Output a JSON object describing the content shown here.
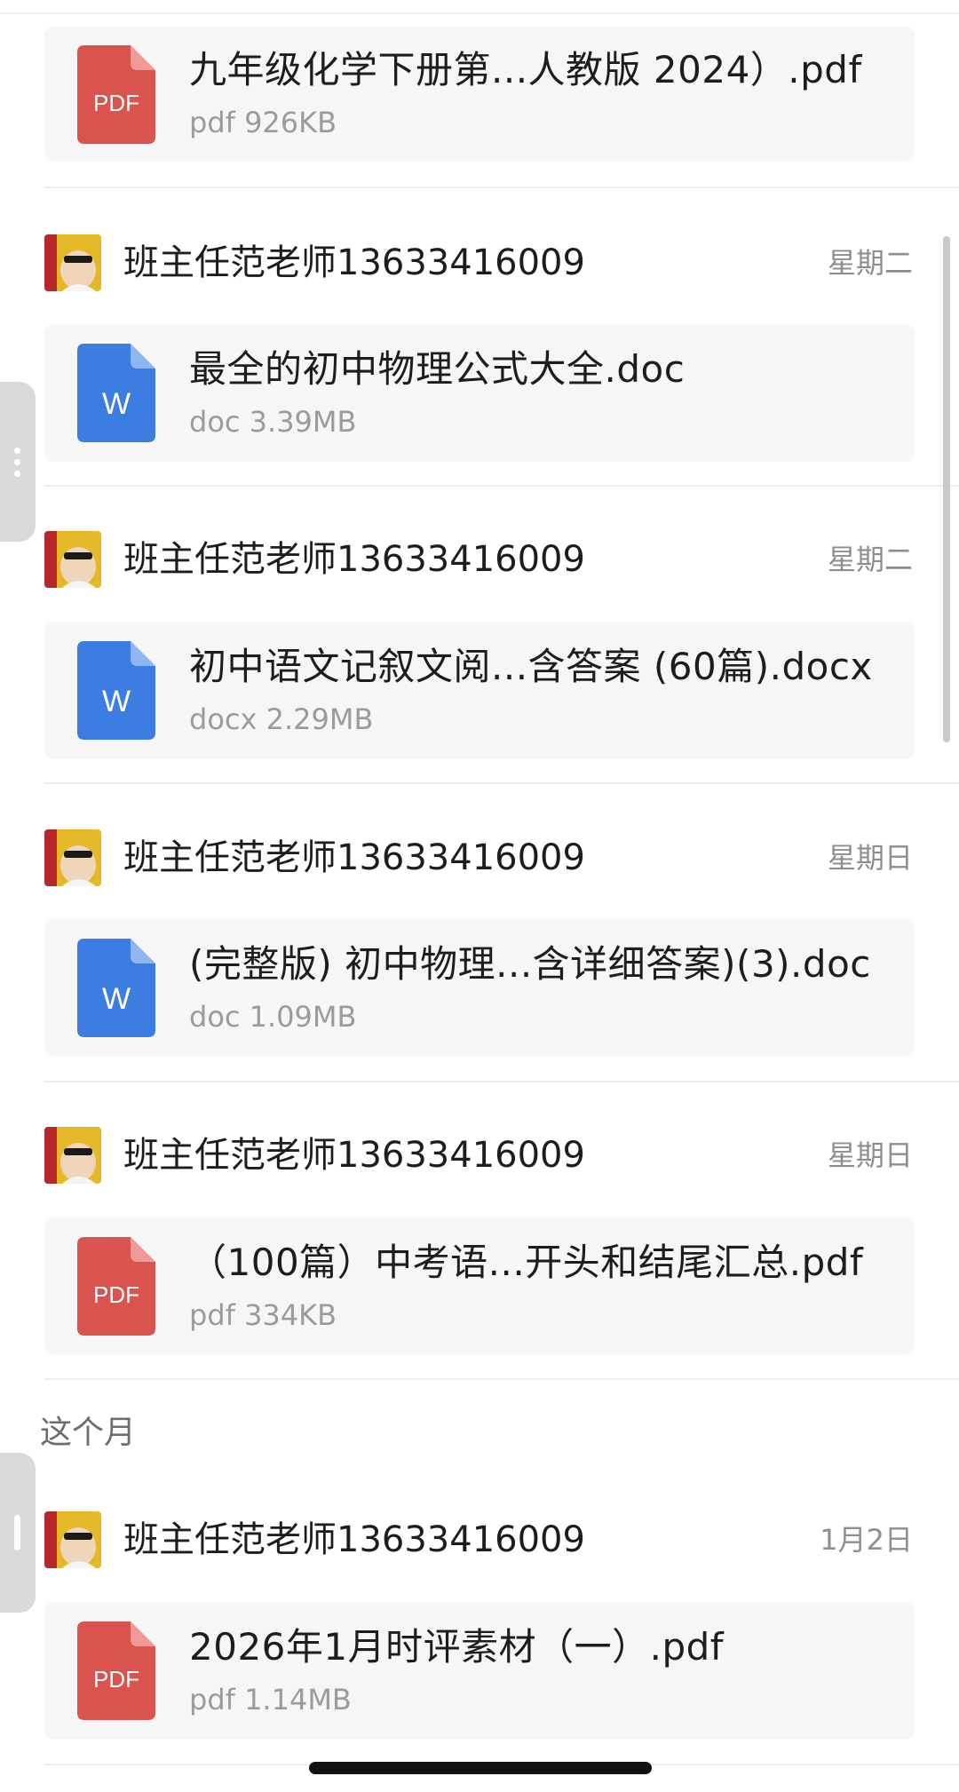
{
  "files": [
    {
      "name": "九年级化学下册第...人教版 2024）.pdf",
      "meta": "pdf 926KB",
      "type": "pdf",
      "icon_label": "PDF"
    },
    {
      "name": "最全的初中物理公式大全.doc",
      "meta": "doc 3.39MB",
      "type": "word",
      "icon_label": "W"
    },
    {
      "name": "初中语文记叙文阅...含答案 (60篇).docx",
      "meta": "docx 2.29MB",
      "type": "word",
      "icon_label": "W"
    },
    {
      "name": "(完整版) 初中物理...含详细答案)(3).doc",
      "meta": "doc 1.09MB",
      "type": "word",
      "icon_label": "W"
    },
    {
      "name": "（100篇）中考语...开头和结尾汇总.pdf",
      "meta": "pdf 334KB",
      "type": "pdf",
      "icon_label": "PDF"
    },
    {
      "name": "2026年1月时评素材（一）.pdf",
      "meta": "pdf 1.14MB",
      "type": "pdf",
      "icon_label": "PDF"
    }
  ],
  "senders": [
    {
      "name": "班主任范老师13633416009",
      "time": "星期二"
    },
    {
      "name": "班主任范老师13633416009",
      "time": "星期二"
    },
    {
      "name": "班主任范老师13633416009",
      "time": "星期日"
    },
    {
      "name": "班主任范老师13633416009",
      "time": "星期日"
    },
    {
      "name": "班主任范老师13633416009",
      "time": "1月2日"
    }
  ],
  "section_this_month": "这个月",
  "colors": {
    "pdf": "#d9534f",
    "pdf_fold": "#ef9a96",
    "word": "#3b7de0",
    "word_fold": "#8fb6f0"
  },
  "icons": {
    "pdf": "pdf-file-icon",
    "word": "word-file-icon",
    "avatar": "avatar",
    "side_handle": "side-menu-handle-icon"
  }
}
